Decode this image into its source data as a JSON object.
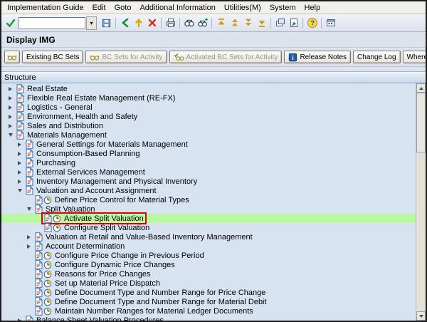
{
  "menu": {
    "items": [
      "Implementation Guide",
      "Edit",
      "Goto",
      "Additional Information",
      "Utilities(M)",
      "System",
      "Help"
    ]
  },
  "toolbar": {
    "command_value": "",
    "icons": [
      "enter",
      "command-field",
      "save",
      "sep",
      "back",
      "exit",
      "cancel",
      "sep",
      "print",
      "sep",
      "find",
      "find-next",
      "sep",
      "first-page",
      "prev-page",
      "next-page",
      "last-page",
      "sep",
      "new-session",
      "shortcut",
      "sep",
      "help",
      "sep",
      "customize"
    ]
  },
  "title": "Display IMG",
  "app_toolbar": {
    "icon_button": "glasses",
    "buttons": [
      {
        "label": "Existing BC Sets",
        "icon": null,
        "enabled": true
      },
      {
        "label": "BC Sets for Activity",
        "icon": "glasses",
        "enabled": false
      },
      {
        "label": "Activated BC Sets for Activity",
        "icon": "check-glasses",
        "enabled": false
      },
      {
        "label": "Release Notes",
        "icon": "info",
        "enabled": true
      },
      {
        "label": "Change Log",
        "icon": null,
        "enabled": true
      },
      {
        "label": "Where Else Used",
        "icon": null,
        "enabled": true
      }
    ]
  },
  "structure_label": "Structure",
  "tree": {
    "items": [
      {
        "label": "Real Estate",
        "level": 0,
        "expander": "collapsed",
        "icons": [
          "page"
        ]
      },
      {
        "label": "Flexible Real Estate Management (RE-FX)",
        "level": 0,
        "expander": "collapsed",
        "icons": [
          "page"
        ]
      },
      {
        "label": "Logistics - General",
        "level": 0,
        "expander": "collapsed",
        "icons": [
          "page"
        ]
      },
      {
        "label": "Environment, Health and Safety",
        "level": 0,
        "expander": "collapsed",
        "icons": [
          "page"
        ]
      },
      {
        "label": "Sales and Distribution",
        "level": 0,
        "expander": "collapsed",
        "icons": [
          "page"
        ]
      },
      {
        "label": "Materials Management",
        "level": 0,
        "expander": "expanded",
        "icons": [
          "page"
        ]
      },
      {
        "label": "General Settings for Materials Management",
        "level": 1,
        "expander": "collapsed",
        "icons": [
          "page"
        ]
      },
      {
        "label": "Consumption-Based Planning",
        "level": 1,
        "expander": "collapsed",
        "icons": [
          "page"
        ]
      },
      {
        "label": "Purchasing",
        "level": 1,
        "expander": "collapsed",
        "icons": [
          "page"
        ]
      },
      {
        "label": "External Services Management",
        "level": 1,
        "expander": "collapsed",
        "icons": [
          "page"
        ]
      },
      {
        "label": "Inventory Management and Physical Inventory",
        "level": 1,
        "expander": "collapsed",
        "icons": [
          "page"
        ]
      },
      {
        "label": "Valuation and Account Assignment",
        "level": 1,
        "expander": "expanded",
        "icons": [
          "page"
        ]
      },
      {
        "label": "Define Price Control for Material Types",
        "level": 2,
        "expander": "none",
        "icons": [
          "page",
          "clock"
        ]
      },
      {
        "label": "Split Valuation",
        "level": 2,
        "expander": "expanded",
        "icons": [
          "page"
        ]
      },
      {
        "label": "Activate Split Valuation",
        "level": 3,
        "expander": "none",
        "icons": [
          "page",
          "clock"
        ],
        "highlighted": true,
        "red_box": true
      },
      {
        "label": "Configure Split Valuation",
        "level": 3,
        "expander": "none",
        "icons": [
          "page",
          "clock"
        ]
      },
      {
        "label": "Valuation at Retail and Value-Based Inventory Management",
        "level": 2,
        "expander": "collapsed",
        "icons": [
          "page"
        ]
      },
      {
        "label": "Account Determination",
        "level": 2,
        "expander": "collapsed",
        "icons": [
          "page"
        ]
      },
      {
        "label": "Configure Price Change in Previous Period",
        "level": 2,
        "expander": "none",
        "icons": [
          "page",
          "clock"
        ]
      },
      {
        "label": "Configure Dynamic Price Changes",
        "level": 2,
        "expander": "none",
        "icons": [
          "page",
          "clock"
        ]
      },
      {
        "label": "Reasons for Price Changes",
        "level": 2,
        "expander": "none",
        "icons": [
          "page",
          "clock"
        ]
      },
      {
        "label": "Set up Material Price Dispatch",
        "level": 2,
        "expander": "none",
        "icons": [
          "page",
          "clock"
        ]
      },
      {
        "label": "Define Document Type and Number Range for Price Change",
        "level": 2,
        "expander": "none",
        "icons": [
          "page",
          "clock"
        ]
      },
      {
        "label": "Define Document Type and Number Range for Material Debit",
        "level": 2,
        "expander": "none",
        "icons": [
          "page",
          "clock"
        ]
      },
      {
        "label": "Maintain Number Ranges for Material Ledger Documents",
        "level": 2,
        "expander": "none",
        "icons": [
          "page",
          "clock"
        ]
      },
      {
        "label": "Balance Sheet Valuation Procedures",
        "level": 1,
        "expander": "collapsed",
        "icons": [
          "page"
        ]
      }
    ]
  },
  "colors": {
    "highlight_green": "#b9f7a3",
    "selection_red": "#e10000",
    "tree_background": "#d7e3f1"
  }
}
